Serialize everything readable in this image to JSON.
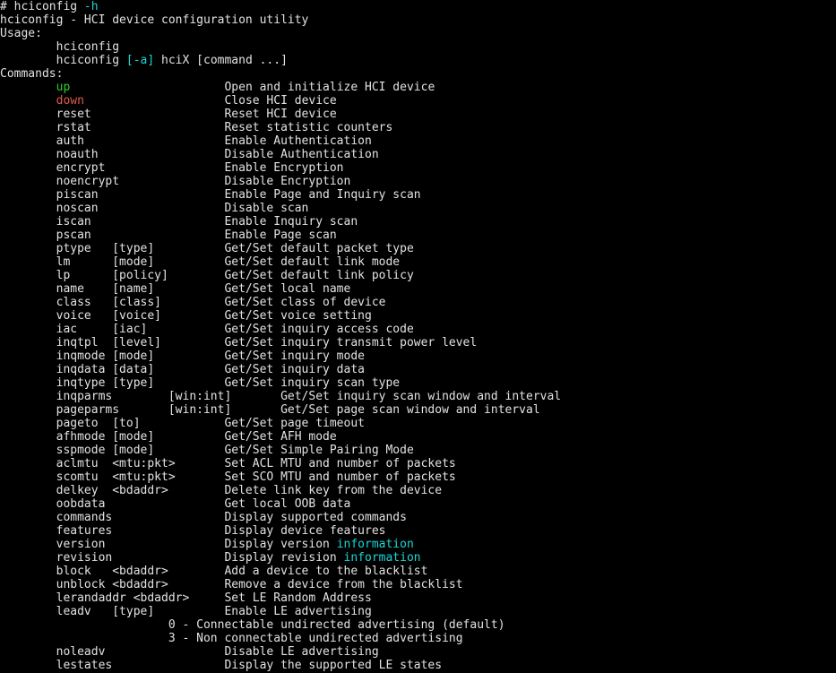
{
  "terminal": {
    "title": "hciconfig -h",
    "background_color": "#000000",
    "default_text_color": "#e2e2e2",
    "cyan_color": "#19d6d6",
    "green_color": "#2ecc2e",
    "red_color": "#e05a4a",
    "prompt_symbol": "#",
    "command_entered": "hciconfig -h"
  },
  "lines": [
    [
      {
        "t": "# hciconfig ",
        "c": "default"
      },
      {
        "t": "-h",
        "c": "cyan"
      }
    ],
    [
      {
        "t": "hciconfig - HCI device configuration utility",
        "c": "default"
      }
    ],
    [
      {
        "t": "Usage:",
        "c": "default"
      }
    ],
    [
      {
        "t": "\thciconfig",
        "c": "default"
      }
    ],
    [
      {
        "t": "\thciconfig ",
        "c": "default"
      },
      {
        "t": "[-a]",
        "c": "cyan"
      },
      {
        "t": " hciX [command ...]",
        "c": "default"
      }
    ],
    [
      {
        "t": "Commands:",
        "c": "default"
      }
    ],
    [
      {
        "t": "\t",
        "c": "default"
      },
      {
        "t": "up",
        "c": "green"
      },
      {
        "t": "\t\t\tOpen and initialize HCI device",
        "c": "default"
      }
    ],
    [
      {
        "t": "\t",
        "c": "default"
      },
      {
        "t": "down",
        "c": "red"
      },
      {
        "t": "\t\t\tClose HCI device",
        "c": "default"
      }
    ],
    [
      {
        "t": "\treset\t\t\tReset HCI device",
        "c": "default"
      }
    ],
    [
      {
        "t": "\trstat\t\t\tReset statistic counters",
        "c": "default"
      }
    ],
    [
      {
        "t": "\tauth\t\t\tEnable Authentication",
        "c": "default"
      }
    ],
    [
      {
        "t": "\tnoauth\t\t\tDisable Authentication",
        "c": "default"
      }
    ],
    [
      {
        "t": "\tencrypt\t\t\tEnable Encryption",
        "c": "default"
      }
    ],
    [
      {
        "t": "\tnoencrypt\t\tDisable Encryption",
        "c": "default"
      }
    ],
    [
      {
        "t": "\tpiscan\t\t\tEnable Page and Inquiry scan",
        "c": "default"
      }
    ],
    [
      {
        "t": "\tnoscan\t\t\tDisable scan",
        "c": "default"
      }
    ],
    [
      {
        "t": "\tiscan\t\t\tEnable Inquiry scan",
        "c": "default"
      }
    ],
    [
      {
        "t": "\tpscan\t\t\tEnable Page scan",
        "c": "default"
      }
    ],
    [
      {
        "t": "\tptype\t[type]\t\tGet/Set default packet type",
        "c": "default"
      }
    ],
    [
      {
        "t": "\tlm\t[mode]\t\tGet/Set default link mode",
        "c": "default"
      }
    ],
    [
      {
        "t": "\tlp\t[policy]\tGet/Set default link policy",
        "c": "default"
      }
    ],
    [
      {
        "t": "\tname\t[name]\t\tGet/Set local name",
        "c": "default"
      }
    ],
    [
      {
        "t": "\tclass\t[class]\t\tGet/Set class of device",
        "c": "default"
      }
    ],
    [
      {
        "t": "\tvoice\t[voice]\t\tGet/Set voice setting",
        "c": "default"
      }
    ],
    [
      {
        "t": "\tiac\t[iac]\t\tGet/Set inquiry access code",
        "c": "default"
      }
    ],
    [
      {
        "t": "\tinqtpl\t[level]\t\tGet/Set inquiry transmit power level",
        "c": "default"
      }
    ],
    [
      {
        "t": "\tinqmode\t[mode]\t\tGet/Set inquiry mode",
        "c": "default"
      }
    ],
    [
      {
        "t": "\tinqdata\t[data]\t\tGet/Set inquiry data",
        "c": "default"
      }
    ],
    [
      {
        "t": "\tinqtype\t[type]\t\tGet/Set inquiry scan type",
        "c": "default"
      }
    ],
    [
      {
        "t": "\tinqparms\t[win:int]\tGet/Set inquiry scan window and interval",
        "c": "default"
      }
    ],
    [
      {
        "t": "\tpageparms\t[win:int]\tGet/Set page scan window and interval",
        "c": "default"
      }
    ],
    [
      {
        "t": "\tpageto\t[to]\t\tGet/Set page timeout",
        "c": "default"
      }
    ],
    [
      {
        "t": "\tafhmode\t[mode]\t\tGet/Set AFH mode",
        "c": "default"
      }
    ],
    [
      {
        "t": "\tsspmode\t[mode]\t\tGet/Set Simple Pairing Mode",
        "c": "default"
      }
    ],
    [
      {
        "t": "\taclmtu\t<mtu:pkt>\tSet ACL MTU and number of packets",
        "c": "default"
      }
    ],
    [
      {
        "t": "\tscomtu\t<mtu:pkt>\tSet SCO MTU and number of packets",
        "c": "default"
      }
    ],
    [
      {
        "t": "\tdelkey\t<bdaddr>\tDelete link key from the device",
        "c": "default"
      }
    ],
    [
      {
        "t": "\toobdata\t\t\tGet local OOB data",
        "c": "default"
      }
    ],
    [
      {
        "t": "\tcommands\t\tDisplay supported commands",
        "c": "default"
      }
    ],
    [
      {
        "t": "\tfeatures\t\tDisplay device features",
        "c": "default"
      }
    ],
    [
      {
        "t": "\tversion\t\t\tDisplay version ",
        "c": "default"
      },
      {
        "t": "information",
        "c": "cyan"
      }
    ],
    [
      {
        "t": "\trevision\t\tDisplay revision ",
        "c": "default"
      },
      {
        "t": "information",
        "c": "cyan"
      }
    ],
    [
      {
        "t": "\tblock\t<bdaddr>\tAdd a device to the blacklist",
        "c": "default"
      }
    ],
    [
      {
        "t": "\tunblock\t<bdaddr>\tRemove a device from the blacklist",
        "c": "default"
      }
    ],
    [
      {
        "t": "\tlerandaddr <bdaddr>\tSet LE Random Address",
        "c": "default"
      }
    ],
    [
      {
        "t": "\tleadv\t[type]\t\tEnable LE advertising",
        "c": "default"
      }
    ],
    [
      {
        "t": "\t\t\t0 - Connectable undirected advertising (default)",
        "c": "default"
      }
    ],
    [
      {
        "t": "\t\t\t3 - Non connectable undirected advertising",
        "c": "default"
      }
    ],
    [
      {
        "t": "\tnoleadv\t\t\tDisable LE advertising",
        "c": "default"
      }
    ],
    [
      {
        "t": "\tlestates\t\tDisplay the supported LE states",
        "c": "default"
      }
    ]
  ]
}
